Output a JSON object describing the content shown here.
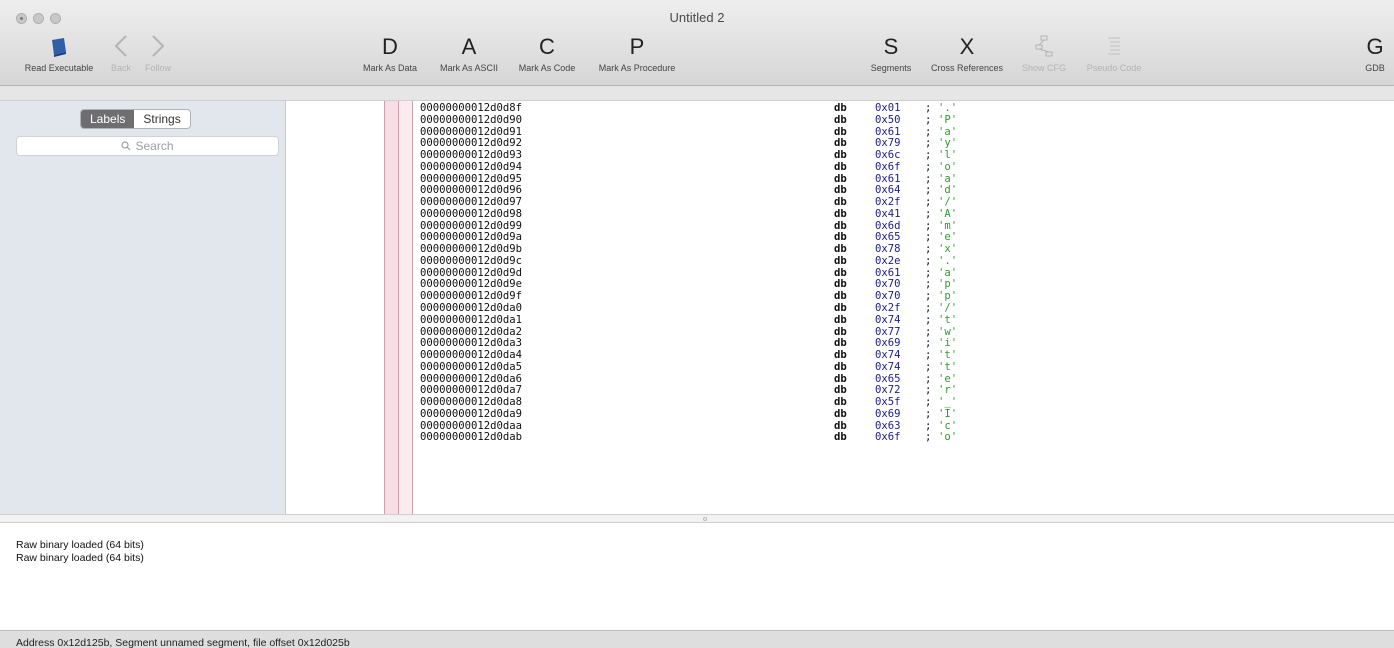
{
  "window": {
    "title": "Untitled 2"
  },
  "toolbar": {
    "left": [
      {
        "name": "read-executable-button",
        "icon": "book-icon",
        "glyph": "",
        "label": "Read Executable",
        "enabled": true
      },
      {
        "name": "back-button",
        "icon": "chevron-left-icon",
        "glyph": "〈",
        "label": "Back",
        "enabled": false
      },
      {
        "name": "follow-button",
        "icon": "chevron-right-icon",
        "glyph": "〉",
        "label": "Follow",
        "enabled": false
      }
    ],
    "marks": [
      {
        "name": "mark-as-data-button",
        "glyph": "D",
        "label": "Mark As Data"
      },
      {
        "name": "mark-as-ascii-button",
        "glyph": "A",
        "label": "Mark As ASCII"
      },
      {
        "name": "mark-as-code-button",
        "glyph": "C",
        "label": "Mark As Code"
      },
      {
        "name": "mark-as-procedure-button",
        "glyph": "P",
        "label": "Mark As Procedure"
      }
    ],
    "right": [
      {
        "name": "segments-button",
        "glyph": "S",
        "label": "Segments",
        "enabled": true
      },
      {
        "name": "cross-references-button",
        "glyph": "X",
        "label": "Cross References",
        "enabled": true
      },
      {
        "name": "show-cfg-button",
        "icon": "cfg-icon",
        "glyph": "⊞",
        "label": "Show CFG",
        "enabled": false
      },
      {
        "name": "pseudo-code-button",
        "icon": "pseudo-code-icon",
        "glyph": "☰",
        "label": "Pseudo Code",
        "enabled": false
      }
    ],
    "gdb": {
      "glyph": "G",
      "label": "GDB"
    }
  },
  "sidebar": {
    "tabs": [
      "Labels",
      "Strings"
    ],
    "active_tab": "Labels",
    "search_placeholder": "Search"
  },
  "listing": [
    {
      "addr": "00000000012d0d8f",
      "op": "db",
      "val": "0x01",
      "chr": "'.'"
    },
    {
      "addr": "00000000012d0d90",
      "op": "db",
      "val": "0x50",
      "chr": "'P'"
    },
    {
      "addr": "00000000012d0d91",
      "op": "db",
      "val": "0x61",
      "chr": "'a'"
    },
    {
      "addr": "00000000012d0d92",
      "op": "db",
      "val": "0x79",
      "chr": "'y'"
    },
    {
      "addr": "00000000012d0d93",
      "op": "db",
      "val": "0x6c",
      "chr": "'l'"
    },
    {
      "addr": "00000000012d0d94",
      "op": "db",
      "val": "0x6f",
      "chr": "'o'"
    },
    {
      "addr": "00000000012d0d95",
      "op": "db",
      "val": "0x61",
      "chr": "'a'"
    },
    {
      "addr": "00000000012d0d96",
      "op": "db",
      "val": "0x64",
      "chr": "'d'"
    },
    {
      "addr": "00000000012d0d97",
      "op": "db",
      "val": "0x2f",
      "chr": "'/'"
    },
    {
      "addr": "00000000012d0d98",
      "op": "db",
      "val": "0x41",
      "chr": "'A'"
    },
    {
      "addr": "00000000012d0d99",
      "op": "db",
      "val": "0x6d",
      "chr": "'m'"
    },
    {
      "addr": "00000000012d0d9a",
      "op": "db",
      "val": "0x65",
      "chr": "'e'"
    },
    {
      "addr": "00000000012d0d9b",
      "op": "db",
      "val": "0x78",
      "chr": "'x'"
    },
    {
      "addr": "00000000012d0d9c",
      "op": "db",
      "val": "0x2e",
      "chr": "'.'"
    },
    {
      "addr": "00000000012d0d9d",
      "op": "db",
      "val": "0x61",
      "chr": "'a'"
    },
    {
      "addr": "00000000012d0d9e",
      "op": "db",
      "val": "0x70",
      "chr": "'p'"
    },
    {
      "addr": "00000000012d0d9f",
      "op": "db",
      "val": "0x70",
      "chr": "'p'"
    },
    {
      "addr": "00000000012d0da0",
      "op": "db",
      "val": "0x2f",
      "chr": "'/'"
    },
    {
      "addr": "00000000012d0da1",
      "op": "db",
      "val": "0x74",
      "chr": "'t'"
    },
    {
      "addr": "00000000012d0da2",
      "op": "db",
      "val": "0x77",
      "chr": "'w'"
    },
    {
      "addr": "00000000012d0da3",
      "op": "db",
      "val": "0x69",
      "chr": "'i'"
    },
    {
      "addr": "00000000012d0da4",
      "op": "db",
      "val": "0x74",
      "chr": "'t'"
    },
    {
      "addr": "00000000012d0da5",
      "op": "db",
      "val": "0x74",
      "chr": "'t'"
    },
    {
      "addr": "00000000012d0da6",
      "op": "db",
      "val": "0x65",
      "chr": "'e'"
    },
    {
      "addr": "00000000012d0da7",
      "op": "db",
      "val": "0x72",
      "chr": "'r'"
    },
    {
      "addr": "00000000012d0da8",
      "op": "db",
      "val": "0x5f",
      "chr": "'_'"
    },
    {
      "addr": "00000000012d0da9",
      "op": "db",
      "val": "0x69",
      "chr": "'I'"
    },
    {
      "addr": "00000000012d0daa",
      "op": "db",
      "val": "0x63",
      "chr": "'c'"
    },
    {
      "addr": "00000000012d0dab",
      "op": "db",
      "val": "0x6f",
      "chr": "'o'"
    }
  ],
  "console": {
    "lines": [
      "Raw binary loaded (64 bits)",
      "Raw binary loaded (64 bits)"
    ]
  },
  "status": {
    "text": "Address 0x12d125b, Segment unnamed segment, file offset 0x12d025b"
  }
}
